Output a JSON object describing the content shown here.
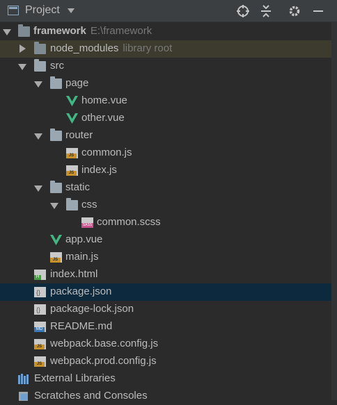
{
  "header": {
    "title": "Project",
    "icons": [
      "project-view-icon",
      "locate-icon",
      "collapse-all-icon",
      "settings-icon",
      "hide-icon"
    ]
  },
  "tree": {
    "root_name": "framework",
    "root_path": "E:\\framework",
    "node_modules": "node_modules",
    "node_modules_hint": "library root",
    "src": "src",
    "page": "page",
    "home_vue": "home.vue",
    "other_vue": "other.vue",
    "router": "router",
    "common_js": "common.js",
    "index_js": "index.js",
    "static": "static",
    "css": "css",
    "common_scss": "common.scss",
    "app_vue": "app.vue",
    "main_js": "main.js",
    "index_html": "index.html",
    "package_json": "package.json",
    "package_lock_json": "package-lock.json",
    "readme_md": "README.md",
    "webpack_base": "webpack.base.config.js",
    "webpack_prod": "webpack.prod.config.js",
    "external_libraries": "External Libraries",
    "scratches": "Scratches and Consoles"
  },
  "selected_item": "package.json",
  "colors": {
    "background": "#2b2b2b",
    "header": "#3c3f41",
    "selection": "#0d293e",
    "vue_green": "#41b883",
    "js_badge": "#c7922c"
  }
}
